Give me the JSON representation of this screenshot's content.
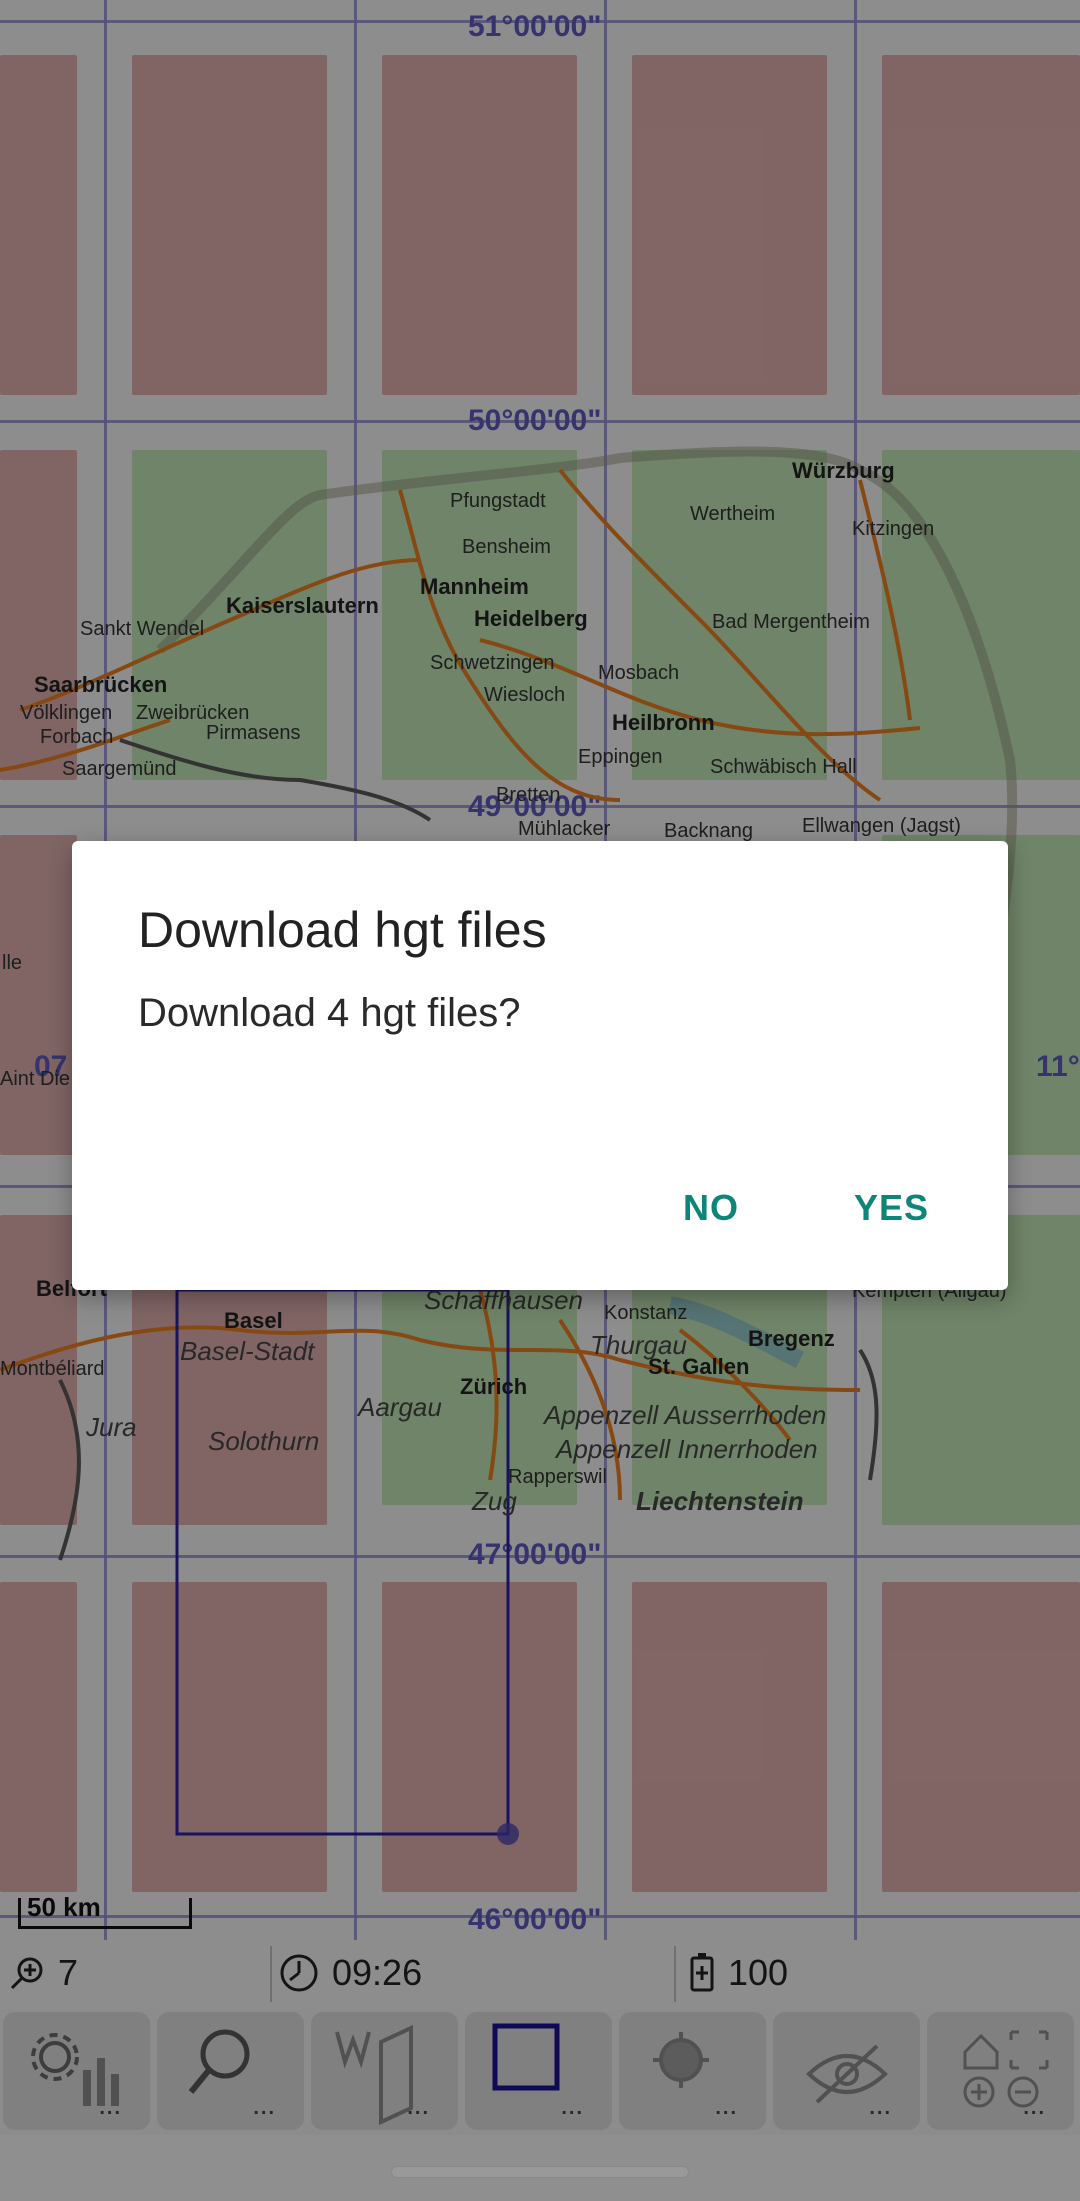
{
  "map": {
    "coords": [
      "51°00'00\"",
      "50°00'00\"",
      "49°00'00\"",
      "47°00'00\"",
      "46°00'00\"",
      "07",
      "11°"
    ],
    "places": [
      "Würzburg",
      "Pfungstadt",
      "Wertheim",
      "Kitzingen",
      "Bensheim",
      "Mannheim",
      "Kaiserslautern",
      "Heidelberg",
      "Sankt Wendel",
      "Bad Mergentheim",
      "Schwetzingen",
      "Mosbach",
      "Saarbrücken",
      "Wiesloch",
      "Völklingen",
      "Zweibrücken",
      "Heilbronn",
      "Forbach",
      "Pirmasens",
      "Schwäbisch Hall",
      "Saargemünd",
      "Eppingen",
      "Bretten",
      "Mühlacker",
      "Backnang",
      "Ellwangen (Jagst)",
      "Schaffhausen",
      "Konstanz",
      "Belfort",
      "Basel",
      "Bregenz",
      "Kempten (Allgäu)",
      "Zürich",
      "St. Gallen",
      "Montbéliard",
      "Rapperswil",
      "Aint Die",
      "lle"
    ],
    "regions": [
      "Basel-Stadt",
      "Thurgau",
      "Aargau",
      "Jura",
      "Solothurn",
      "Appenzell Ausserrhoden",
      "Appenzell Innerrhoden",
      "Liechtenstein",
      "Zug"
    ],
    "scale_label": "50 km"
  },
  "status": {
    "zoom": "7",
    "time": "09:26",
    "battery": "100"
  },
  "toolbar": {
    "buttons": [
      "settings-stats",
      "search",
      "waypoint-route",
      "area-select",
      "location",
      "visibility",
      "zoom-home"
    ],
    "dots": "..."
  },
  "dialog": {
    "title": "Download hgt files",
    "message": "Download 4 hgt files?",
    "no_label": "NO",
    "yes_label": "YES"
  }
}
